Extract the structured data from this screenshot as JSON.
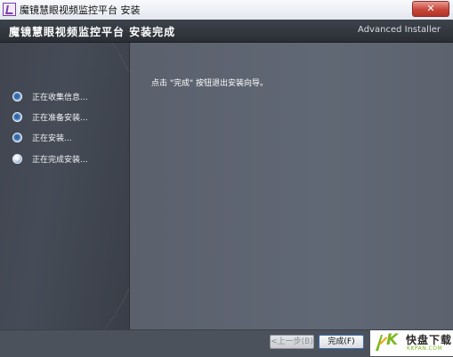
{
  "window": {
    "title": "魔镜慧眼视频监控平台 安装",
    "close_glyph": "✕"
  },
  "header": {
    "title": "魔镜慧眼视频监控平台 安装完成",
    "brand": "Advanced Installer"
  },
  "steps": [
    {
      "label": "正在收集信息...",
      "state": "done"
    },
    {
      "label": "正在准备安装...",
      "state": "done"
    },
    {
      "label": "正在安装...",
      "state": "done"
    },
    {
      "label": "正在完成安装...",
      "state": "current"
    }
  ],
  "main": {
    "message": "点击 \"完成\" 按钮退出安装向导。"
  },
  "buttons": {
    "back_label": "<上一步(B)",
    "finish_label": "完成(F)"
  },
  "watermark": {
    "k": "K",
    "main": "快盘下载",
    "sub": "KKPAN.COM"
  },
  "colors": {
    "header_bg": "#2f343b",
    "panel_bg": "#5a616d",
    "accent_blue": "#3f6fb0",
    "watermark_green": "#7cb81f"
  }
}
